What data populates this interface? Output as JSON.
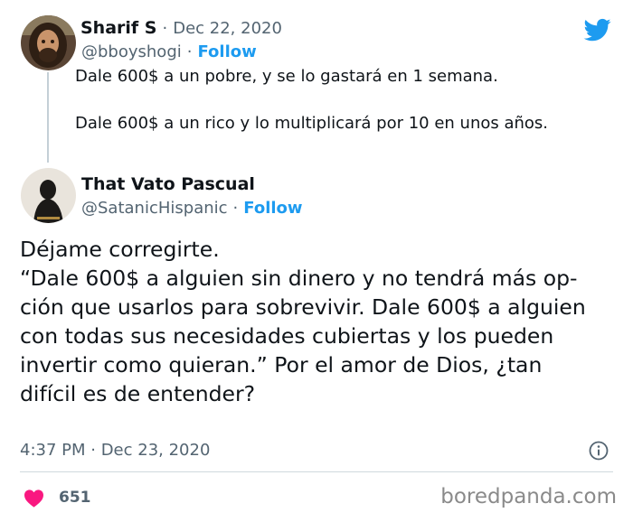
{
  "original_tweet": {
    "display_name": "Sharif S",
    "separator": "·",
    "date": "Dec 22, 2020",
    "handle": "@bboyshogi",
    "follow_separator": "·",
    "follow_label": "Follow",
    "text": "Dale 600$ a un pobre, y se lo gastará en 1 semana.\n\nDale 600$ a un rico y lo multiplicará por 10 en unos años."
  },
  "reply_tweet": {
    "display_name": "That Vato Pascual",
    "handle": "@SatanicHispanic",
    "follow_separator": "·",
    "follow_label": "Follow",
    "text": "Déjame corregirte.\n“Dale 600$ a alguien sin dinero y no tendrá más op-\nción que usarlos para sobrevivir. Dale 600$ a alguien\ncon todas sus necesidades cubiertas y los pueden\ninvertir como quieran.” Por el amor de Dios, ¿tan\ndifícil es de entender?",
    "timestamp": "4:37 PM · Dec 23, 2020",
    "like_count": "651"
  },
  "watermark": "boredpanda.com",
  "colors": {
    "twitter_blue": "#1d9bf0",
    "heart_pink": "#f91880",
    "muted_gray": "#536471"
  },
  "icons": {
    "brand": "twitter-bird-icon",
    "info": "info-icon",
    "like": "heart-icon"
  }
}
